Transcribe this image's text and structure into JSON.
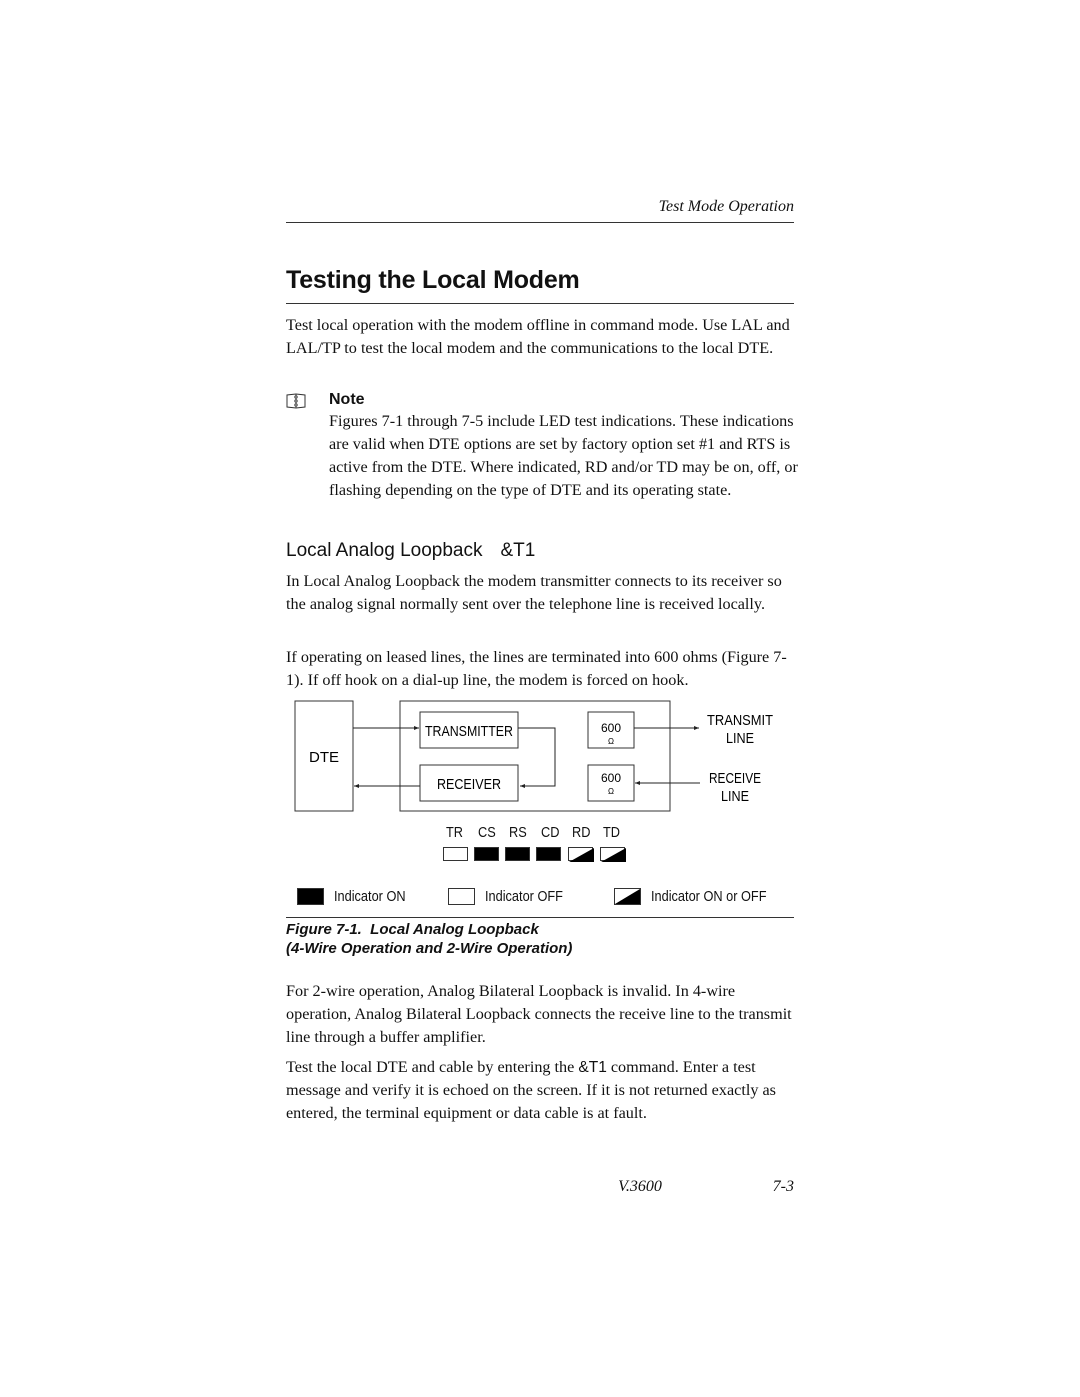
{
  "header": {
    "running_title": "Test Mode Operation"
  },
  "page_title": "Testing the Local Modem",
  "intro_paragraph": "Test local operation with the modem offline in command mode. Use LAL and LAL/TP to test the local modem and the communications to the local DTE.",
  "note": {
    "icon": "note-book-icon",
    "label": "Note",
    "text": "Figures 7-1 through 7-5 include LED test indications. These indications are valid when DTE options are set by factory option set #1 and RTS is active from the DTE. Where indicated, RD and/or TD may be on, off, or flashing depending on the type of DTE and its operating state."
  },
  "section": {
    "heading": "Local Analog Loopback",
    "command": "&T1",
    "paragraphs": [
      "In Local Analog Loopback the modem transmitter connects to its receiver so the analog signal normally sent over the telephone line is received locally.",
      "If operating on leased lines, the lines are terminated into 600 ohms (Figure 7-1). If off hook on a dial-up line, the modem is forced on hook."
    ]
  },
  "diagram": {
    "dte_label": "DTE",
    "transmitter_label": "TRANSMITTER",
    "receiver_label": "RECEIVER",
    "resistor_value": "600",
    "resistor_unit": "Ω",
    "transmit_line_label_1": "TRANSMIT",
    "transmit_line_label_2": "LINE",
    "receive_line_label_1": "RECEIVE",
    "receive_line_label_2": "LINE"
  },
  "leds": [
    {
      "label": "TR",
      "state": "off"
    },
    {
      "label": "CS",
      "state": "on"
    },
    {
      "label": "RS",
      "state": "on"
    },
    {
      "label": "CD",
      "state": "on"
    },
    {
      "label": "RD",
      "state": "on-or-off"
    },
    {
      "label": "TD",
      "state": "on-or-off"
    }
  ],
  "legend": {
    "on": "Indicator ON",
    "off": "Indicator OFF",
    "either": "Indicator ON or OFF"
  },
  "figure_caption": {
    "line1": "Figure 7-1.  Local Analog Loopback",
    "line2": "(4-Wire Operation and 2-Wire Operation)"
  },
  "after_figure": {
    "paragraph1": "For 2-wire operation, Analog Bilateral Loopback is invalid. In 4-wire operation, Analog Bilateral Loopback connects the receive line to the transmit line through a buffer amplifier.",
    "paragraph2_before": "Test the local DTE and cable by entering the ",
    "paragraph2_command": "&T1",
    "paragraph2_after": " command. Enter a test message and verify it is echoed on the screen. If it is not returned exactly as entered, the terminal equipment or data cable is at fault."
  },
  "footer": {
    "document": "V.3600",
    "page_number": "7-3"
  }
}
